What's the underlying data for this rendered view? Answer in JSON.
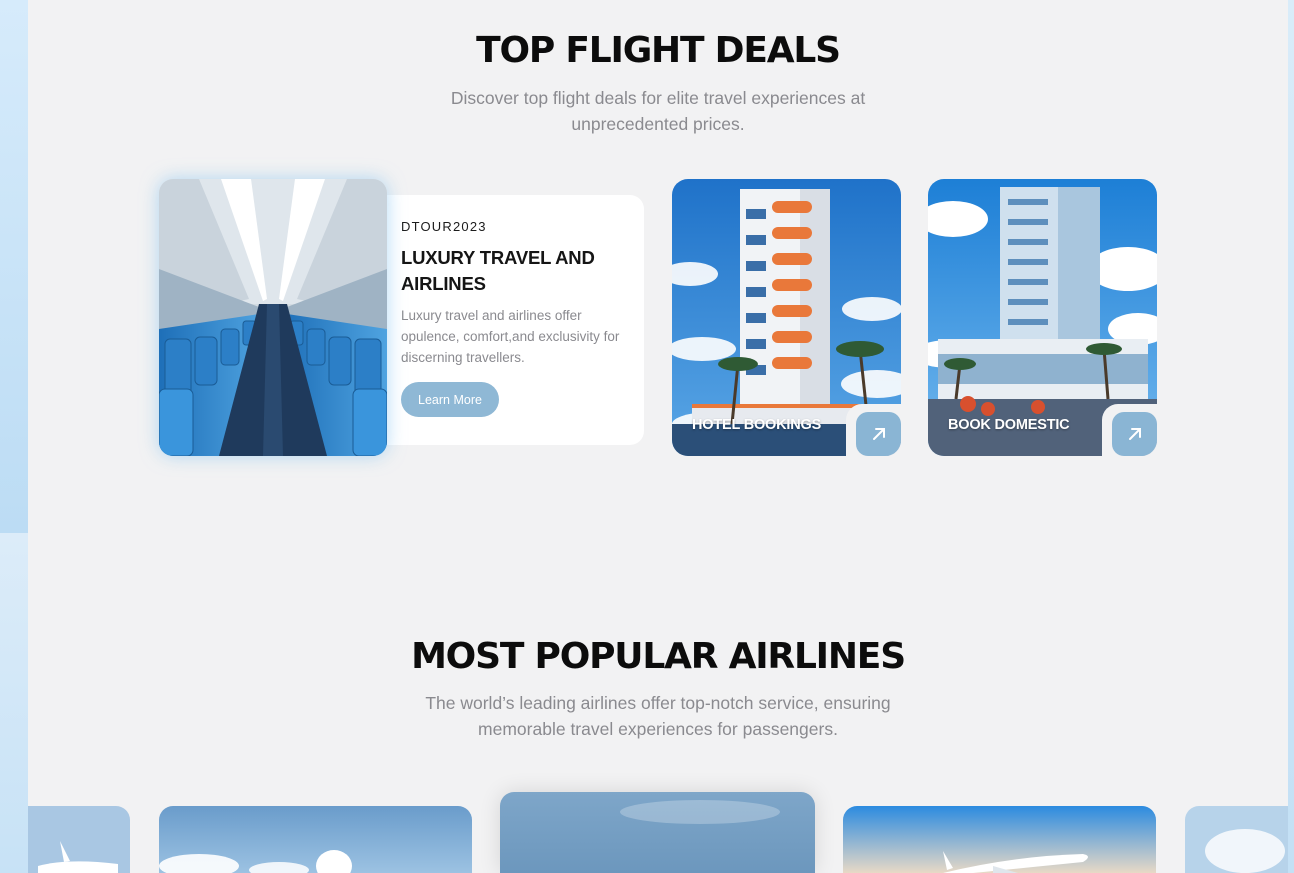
{
  "deals": {
    "title": "TOP FLIGHT DEALS",
    "subtitle_line1": "Discover top flight deals for elite travel experiences at",
    "subtitle_line2": "unprecedented prices.",
    "featured": {
      "code": "DTOUR2023",
      "title": "LUXURY TRAVEL AND AIRLINES",
      "description": "Luxury travel and airlines offer opulence, comfort,and exclusivity for discerning travellers.",
      "button_label": "Learn More",
      "image": "airplane-cabin-interior"
    },
    "tiles": [
      {
        "label": "HOTEL BOOKINGS",
        "image": "hotel-tower-palm-trees",
        "icon": "arrow-up-right-icon"
      },
      {
        "label": "BOOK DOMESTIC",
        "image": "glass-hotel-building",
        "icon": "arrow-up-right-icon"
      }
    ]
  },
  "airlines": {
    "title": "MOST POPULAR AIRLINES",
    "subtitle_line1": "The world’s leading airlines offer top-notch service, ensuring",
    "subtitle_line2": "memorable travel experiences for passengers.",
    "cards": [
      "plane-left-partial",
      "plane-in-sky",
      "sky-center-featured",
      "plane-in-flight",
      "sky-right-partial"
    ]
  },
  "colors": {
    "page_bg": "#f2f2f3",
    "accent": "#8ab5d4",
    "outer_bg": "#cfe6f7"
  }
}
